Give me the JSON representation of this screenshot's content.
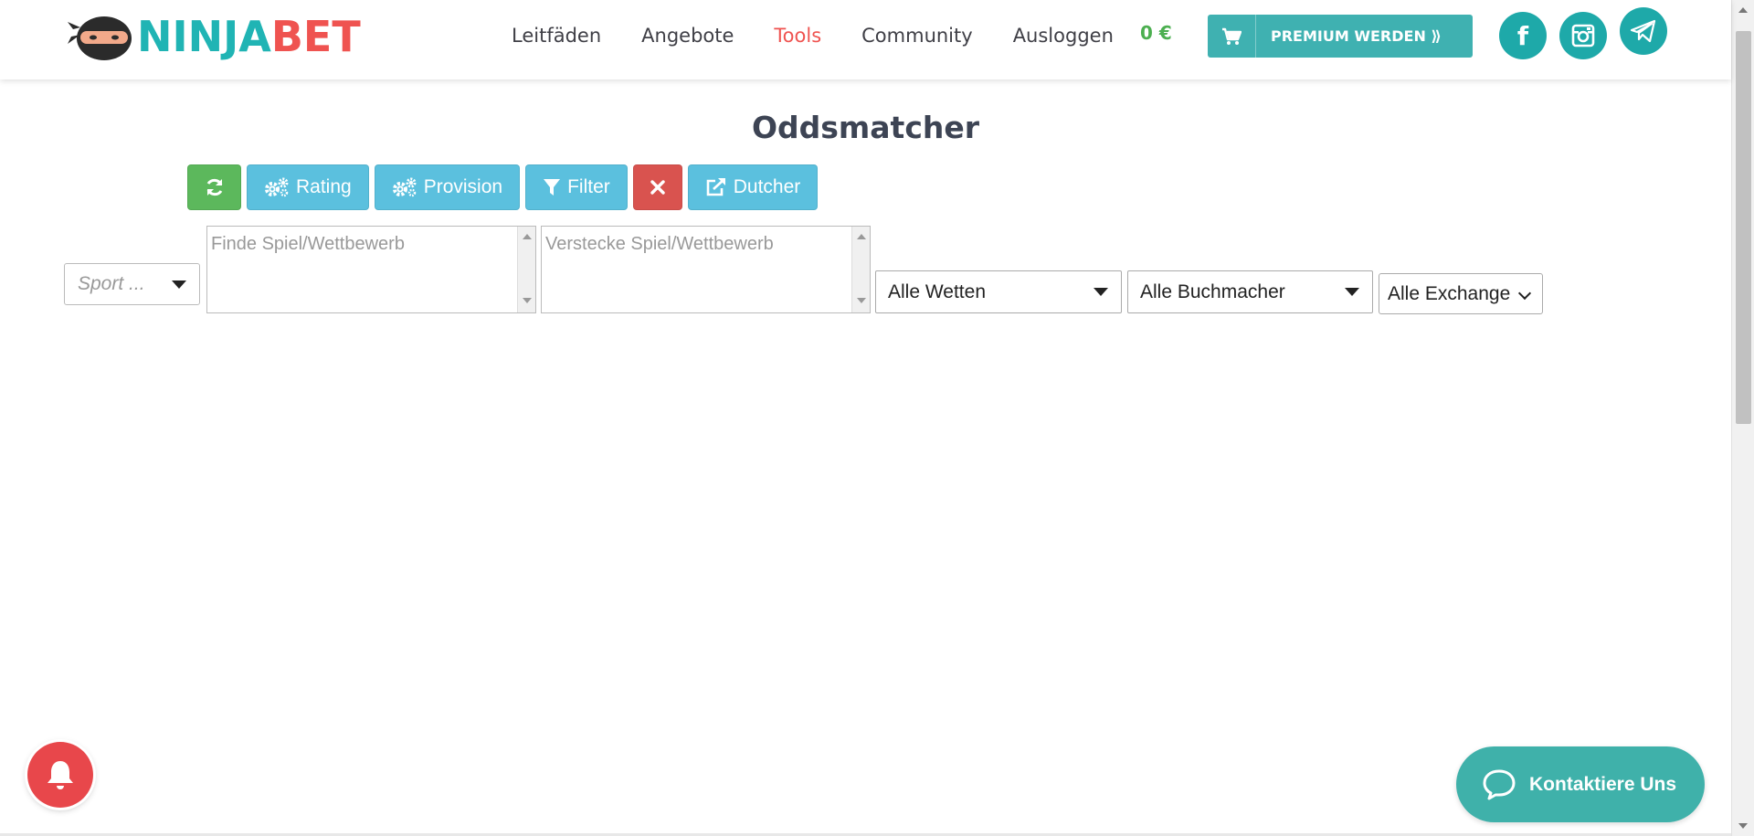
{
  "header": {
    "logo_part1": "NINJA",
    "logo_part2": "BET",
    "nav": [
      {
        "label": "Leitfäden",
        "active": false
      },
      {
        "label": "Angebote",
        "active": false
      },
      {
        "label": "Tools",
        "active": true
      },
      {
        "label": "Community",
        "active": false
      },
      {
        "label": "Ausloggen",
        "active": false
      }
    ],
    "balance": "0 €",
    "premium_label": "PREMIUM WERDEN ⟫",
    "facebook_glyph": "f"
  },
  "page": {
    "title": "Oddsmatcher"
  },
  "toolbar": {
    "rating_label": "Rating",
    "provision_label": "Provision",
    "filter_label": "Filter",
    "dutcher_label": "Dutcher"
  },
  "filters": {
    "sport_placeholder": "Sport ...",
    "find_placeholder": "Finde Spiel/Wettbewerb",
    "hide_placeholder": "Verstecke Spiel/Wettbewerb",
    "bets_value": "Alle Wetten",
    "bookmaker_value": "Alle Buchmacher",
    "exchange_value": "Alle Exchange"
  },
  "contact": {
    "label": "Kontaktiere Uns"
  },
  "colors": {
    "teal": "#20b4b4",
    "red_accent": "#ef5350",
    "green": "#5cb85c",
    "info_blue": "#5bc0de",
    "danger": "#d9534f",
    "balance_green": "#4caf50"
  }
}
